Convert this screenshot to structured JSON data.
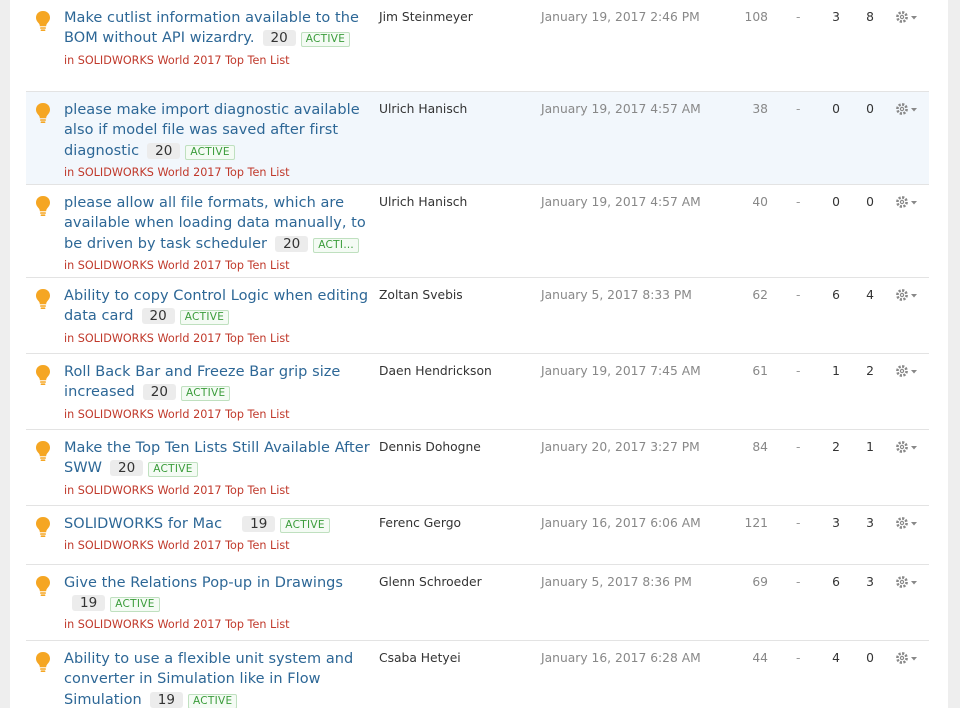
{
  "colors": {
    "title": "#2d6796",
    "category": "#c0392b",
    "status_text": "#3a9c3a",
    "bulb": "#f5a623",
    "highlight_row": "#f2f7fc"
  },
  "category_prefix": "in",
  "ideas": [
    {
      "icon": "lightbulb-icon",
      "title": "Make cutlist information available to the BOM without API wizardry.",
      "score": "20",
      "status": "ACTIVE",
      "category": "SOLIDWORKS World 2017 Top Ten List",
      "author": "Jim Steinmeyer",
      "date": "January 19, 2017 2:46 PM",
      "views": "108",
      "dash": "-",
      "count1": "3",
      "count2": "8"
    },
    {
      "icon": "lightbulb-icon",
      "title": "please make import diagnostic available also if model file was saved after first diagnostic",
      "score": "20",
      "status": "ACTIVE",
      "category": "SOLIDWORKS World 2017 Top Ten List",
      "author": "Ulrich Hanisch",
      "date": "January 19, 2017 4:57 AM",
      "views": "38",
      "dash": "-",
      "count1": "0",
      "count2": "0"
    },
    {
      "icon": "lightbulb-icon",
      "title": "please allow all file formats, which are available when loading data manually, to be driven by task scheduler",
      "score": "20",
      "status": "ACTIVE",
      "category": "SOLIDWORKS World 2017 Top Ten List",
      "author": "Ulrich Hanisch",
      "date": "January 19, 2017 4:57 AM",
      "views": "40",
      "dash": "-",
      "count1": "0",
      "count2": "0"
    },
    {
      "icon": "lightbulb-icon",
      "title": "Ability to copy Control Logic when editing data card",
      "score": "20",
      "status": "ACTIVE",
      "category": "SOLIDWORKS World 2017 Top Ten List",
      "author": "Zoltan Svebis",
      "date": "January 5, 2017 8:33 PM",
      "views": "62",
      "dash": "-",
      "count1": "6",
      "count2": "4"
    },
    {
      "icon": "lightbulb-icon",
      "title": "Roll Back Bar and Freeze Bar grip size increased",
      "score": "20",
      "status": "ACTIVE",
      "category": "SOLIDWORKS World 2017 Top Ten List",
      "author": "Daen Hendrickson",
      "date": "January 19, 2017 7:45 AM",
      "views": "61",
      "dash": "-",
      "count1": "1",
      "count2": "2"
    },
    {
      "icon": "lightbulb-icon",
      "title": "Make the Top Ten Lists Still Available After SWW",
      "score": "20",
      "status": "ACTIVE",
      "category": "SOLIDWORKS World 2017 Top Ten List",
      "author": "Dennis Dohogne",
      "date": "January 20, 2017 3:27 PM",
      "views": "84",
      "dash": "-",
      "count1": "2",
      "count2": "1"
    },
    {
      "icon": "lightbulb-icon",
      "title": "SOLIDWORKS for Mac",
      "score": "19",
      "status": "ACTIVE",
      "category": "SOLIDWORKS World 2017 Top Ten List",
      "author": "Ferenc Gergo",
      "date": "January 16, 2017 6:06 AM",
      "views": "121",
      "dash": "-",
      "count1": "3",
      "count2": "3"
    },
    {
      "icon": "lightbulb-icon",
      "title": "Give the Relations Pop-up in Drawings",
      "score": "19",
      "status": "ACTIVE",
      "category": "SOLIDWORKS World 2017 Top Ten List",
      "author": "Glenn Schroeder",
      "date": "January 5, 2017 8:36 PM",
      "views": "69",
      "dash": "-",
      "count1": "6",
      "count2": "3"
    },
    {
      "icon": "lightbulb-icon",
      "title": "Ability to use a flexible unit system and converter in Simulation like in Flow Simulation",
      "score": "19",
      "status": "ACTIVE",
      "category": "",
      "author": "Csaba Hetyei",
      "date": "January 16, 2017 6:28 AM",
      "views": "44",
      "dash": "-",
      "count1": "4",
      "count2": "0"
    }
  ]
}
